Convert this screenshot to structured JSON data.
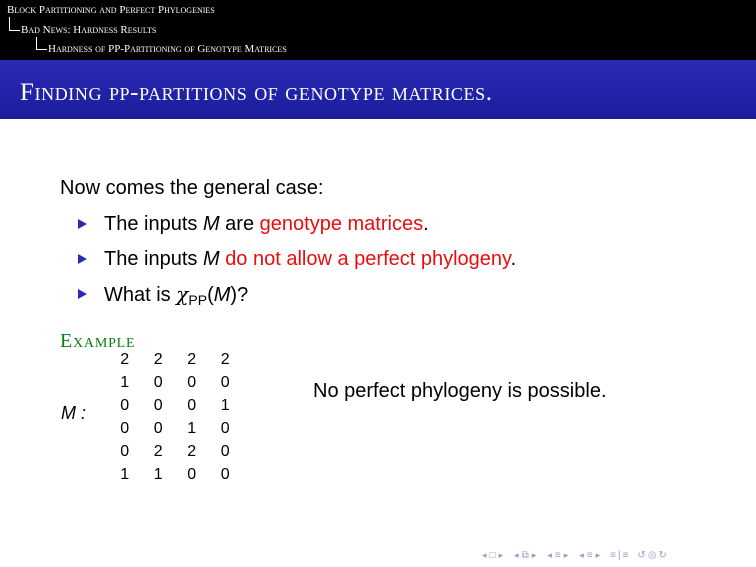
{
  "headline": {
    "line1": "Block Partitioning and Perfect Phylogenies",
    "line2": "Bad News: Hardness Results",
    "line3": "Hardness of PP-Partitioning of Genotype Matrices"
  },
  "frame": {
    "title": "Finding pp-partitions of genotype matrices."
  },
  "body": {
    "intro": "Now comes the general case:",
    "bullets": [
      {
        "prefix": "The inputs ",
        "var": "M",
        "mid": " are ",
        "highlight": "genotype matrices",
        "suffix": "."
      },
      {
        "prefix": "The inputs ",
        "var": "M",
        "mid": " ",
        "highlight": "do not allow a perfect phylogeny",
        "suffix": "."
      },
      {
        "prefix": "What is ",
        "chi": "χ",
        "sub": "PP",
        "paren_open": "(",
        "var": "M",
        "paren_close": ")?"
      }
    ]
  },
  "example": {
    "title": "Example",
    "matrix_label": "M :",
    "matrix": [
      [
        "2",
        "2",
        "2",
        "2"
      ],
      [
        "1",
        "0",
        "0",
        "0"
      ],
      [
        "0",
        "0",
        "0",
        "1"
      ],
      [
        "0",
        "0",
        "1",
        "0"
      ],
      [
        "0",
        "2",
        "2",
        "0"
      ],
      [
        "1",
        "1",
        "0",
        "0"
      ]
    ],
    "note": "No perfect phylogeny is possible."
  },
  "colors": {
    "title_bar": "#1b1c9c",
    "highlight": "#ea0d0d",
    "example_title": "#0d7d0d",
    "bullet": "#2a2bb5"
  },
  "navigation": {
    "icons": [
      "nav-first-icon",
      "nav-frame-prev-icon",
      "nav-frame-next-icon",
      "nav-subsection-icon",
      "nav-section-icon",
      "nav-doc-icon",
      "nav-search-icon"
    ]
  }
}
